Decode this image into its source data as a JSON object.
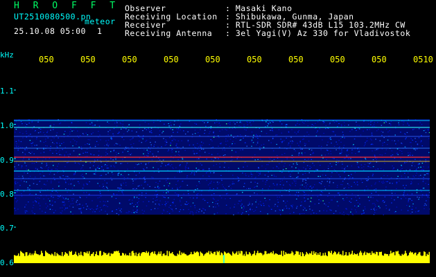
{
  "header": {
    "title": "H R O F F T",
    "filename": "UT2510080500.pn",
    "meteor_label": "meteor",
    "timestamp": "25.10.08 05:00",
    "count": "1"
  },
  "info": [
    {
      "label": "Observer",
      "value": ": Masaki Kano"
    },
    {
      "label": "Receiving Location",
      "value": ": Shibukawa, Gunma, Japan"
    },
    {
      "label": "Receiver",
      "value": ": RTL-SDR SDR# 43dB L15 103.2MHz CW"
    },
    {
      "label": "Receiving Antenna",
      "value": ": 3el Yagi(V) Az 330 for Vladivostok"
    }
  ],
  "axis": {
    "y_unit": "kHz",
    "y_ticks": [
      "1.1",
      "1.0",
      "0.9",
      "0.8",
      "0.7",
      "0.6"
    ],
    "x_ticks": [
      "050",
      "050",
      "050",
      "050",
      "050",
      "050",
      "050",
      "050",
      "050",
      "0510"
    ]
  },
  "colors": {
    "background": "#000000",
    "header_green": "#00ff66",
    "header_cyan": "#00ffff",
    "axis_yellow": "#ffff00",
    "signal_red": "#ff2020",
    "noise_blue": "#1020ff"
  }
}
